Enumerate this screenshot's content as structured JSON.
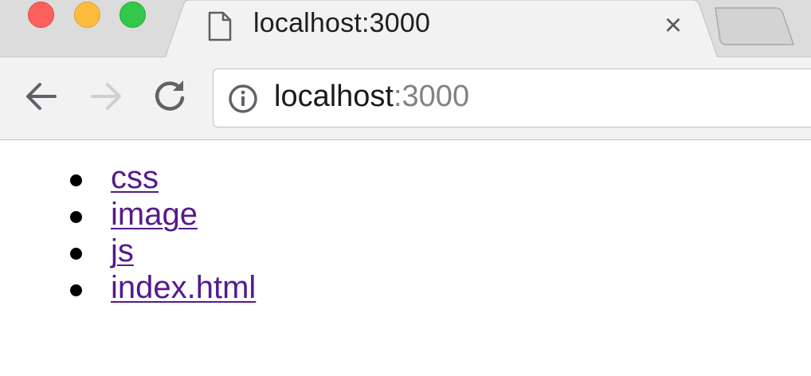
{
  "window": {
    "controls": [
      "close",
      "minimize",
      "zoom"
    ]
  },
  "tab": {
    "title": "localhost:3000",
    "icon": "file-icon",
    "close_glyph": "×"
  },
  "toolbar": {
    "back_icon": "arrow-left-icon",
    "forward_icon": "arrow-right-icon",
    "reload_icon": "reload-icon"
  },
  "address_bar": {
    "icon": "info-icon",
    "host": "localhost",
    "port": ":3000"
  },
  "page": {
    "links": [
      {
        "label": "css"
      },
      {
        "label": "image"
      },
      {
        "label": "js"
      },
      {
        "label": "index.html"
      }
    ]
  },
  "colors": {
    "link_visited": "#551a8b",
    "traffic_close": "#fc605c",
    "traffic_minimize": "#fdbc40",
    "traffic_zoom": "#34c84a",
    "tabstrip_bg": "#dcdcdc",
    "toolbar_bg": "#f2f2f2"
  }
}
